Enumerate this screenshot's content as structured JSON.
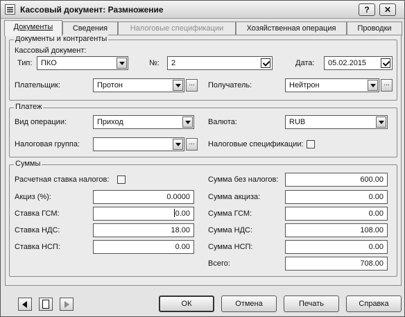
{
  "window": {
    "title": "Кассовый документ: Размножение",
    "help_label": "?",
    "close_label": "✕"
  },
  "tabs": [
    {
      "label": "Документы",
      "state": "active"
    },
    {
      "label": "Сведения",
      "state": "normal"
    },
    {
      "label": "Налоговые спецификации",
      "state": "disabled"
    },
    {
      "label": "Хозяйственная операция",
      "state": "normal"
    },
    {
      "label": "Проводки",
      "state": "normal"
    }
  ],
  "documents_group": {
    "title": "Документы и контрагенты",
    "doc_label": "Кассовый документ:",
    "type_label": "Тип:",
    "type_value": "ПКО",
    "number_label": "№:",
    "number_value": "2",
    "date_label": "Дата:",
    "date_value": "05.02.2015",
    "payer_label": "Плательщик:",
    "payer_value": "Протон",
    "recipient_label": "Получатель:",
    "recipient_value": "Нейтрон",
    "ellipsis": "..."
  },
  "payment_group": {
    "title": "Платеж",
    "operation_label": "Вид операции:",
    "operation_value": "Приход",
    "currency_label": "Валюта:",
    "currency_value": "RUB",
    "tax_group_label": "Налоговая группа:",
    "tax_group_value": "",
    "tax_specs_label": "Налоговые спецификации:",
    "tax_specs_checked": false,
    "ellipsis": "..."
  },
  "sums_group": {
    "title": "Суммы",
    "calc_rate_label": "Расчетная ставка налогов:",
    "calc_rate_checked": false,
    "excise_pct_label": "Акциз (%):",
    "excise_pct_value": "0.0000",
    "gsm_rate_label": "Ставка ГСМ:",
    "gsm_rate_value": "0.00",
    "vat_rate_label": "Ставка НДС:",
    "vat_rate_value": "18.00",
    "nsp_rate_label": "Ставка НСП:",
    "nsp_rate_value": "0.00",
    "sum_no_tax_label": "Сумма без налогов:",
    "sum_no_tax_value": "600.00",
    "sum_excise_label": "Сумма акциза:",
    "sum_excise_value": "0.00",
    "sum_gsm_label": "Сумма ГСМ:",
    "sum_gsm_value": "0.00",
    "sum_vat_label": "Сумма НДС:",
    "sum_vat_value": "108.00",
    "sum_nsp_label": "Сумма НСП:",
    "sum_nsp_value": "0.00",
    "total_label": "Всего:",
    "total_value": "708.00"
  },
  "footer": {
    "ok": "ОК",
    "cancel": "Отмена",
    "print": "Печать",
    "help": "Справка"
  },
  "icons": {
    "nav_prev": "arrow-left-icon",
    "nav_doc": "document-icon",
    "nav_next": "arrow-right-icon"
  }
}
